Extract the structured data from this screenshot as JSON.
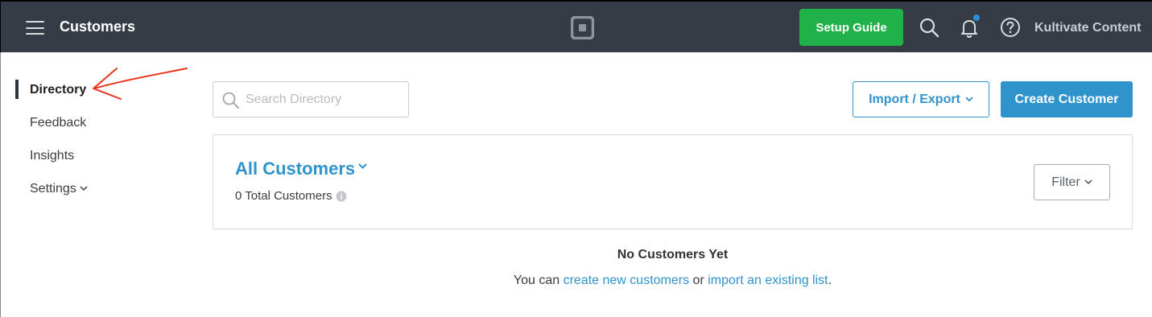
{
  "header": {
    "title": "Customers",
    "setup_label": "Setup Guide",
    "account_name": "Kultivate Content",
    "icons": [
      "hamburger-icon",
      "square-logo-icon",
      "search-icon",
      "bell-icon",
      "help-icon"
    ]
  },
  "sidebar": {
    "items": [
      {
        "label": "Directory",
        "active": true
      },
      {
        "label": "Feedback"
      },
      {
        "label": "Insights"
      },
      {
        "label": "Settings",
        "has_dropdown": true
      }
    ]
  },
  "toolbar": {
    "search_placeholder": "Search Directory",
    "import_label": "Import / Export",
    "create_label": "Create Customer"
  },
  "panel": {
    "title": "All Customers",
    "total_text": "0 Total Customers",
    "filter_label": "Filter"
  },
  "empty_state": {
    "title": "No Customers Yet",
    "prefix": "You can ",
    "link1": "create new customers",
    "middle": " or ",
    "link2": "import an existing list",
    "suffix": "."
  },
  "colors": {
    "topbar": "#353c45",
    "setup": "#20b14a",
    "accent": "#2f93cc",
    "annotation": "#e8341c"
  }
}
